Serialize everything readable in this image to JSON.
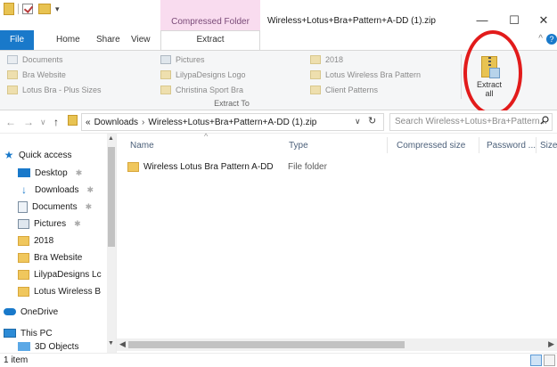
{
  "window": {
    "title": "Wireless+Lotus+Bra+Pattern+A-DD (1).zip",
    "context_tab_header": "Compressed Folder Tools",
    "minimize": "—",
    "maximize": "☐",
    "close": "✕"
  },
  "tabs": {
    "file": "File",
    "home": "Home",
    "share": "Share",
    "view": "View",
    "extract": "Extract"
  },
  "ribbon": {
    "col1": [
      "Documents",
      "Bra Website",
      "Lotus Bra - Plus Sizes"
    ],
    "col2": [
      "Pictures",
      "LilypaDesigns Logo",
      "Christina Sport Bra"
    ],
    "col3": [
      "2018",
      "Lotus Wireless Bra Pattern",
      "Client Patterns"
    ],
    "group_label": "Extract To",
    "extract_all_line1": "Extract",
    "extract_all_line2": "all"
  },
  "address": {
    "overflow": "«",
    "downloads": "Downloads",
    "current": "Wireless+Lotus+Bra+Pattern+A-DD (1).zip",
    "separator": "›",
    "search_placeholder": "Search Wireless+Lotus+Bra+Pattern..."
  },
  "nav": {
    "items": [
      {
        "label": "Quick access",
        "icon": "star-icon"
      },
      {
        "label": "Desktop",
        "icon": "desktop-icon"
      },
      {
        "label": "Downloads",
        "icon": "download-icon"
      },
      {
        "label": "Documents",
        "icon": "document-icon"
      },
      {
        "label": "Pictures",
        "icon": "pictures-icon"
      },
      {
        "label": "2018",
        "icon": "folder-icon"
      },
      {
        "label": "Bra Website",
        "icon": "folder-icon"
      },
      {
        "label": "LilypaDesigns Lc",
        "icon": "folder-icon"
      },
      {
        "label": "Lotus Wireless B",
        "icon": "folder-icon"
      },
      {
        "label": "OneDrive",
        "icon": "cloud-icon"
      },
      {
        "label": "This PC",
        "icon": "pc-icon"
      },
      {
        "label": "3D Objects",
        "icon": "3d-objects-icon"
      }
    ]
  },
  "columns": {
    "name": "Name",
    "type": "Type",
    "compressed_size": "Compressed size",
    "password": "Password ...",
    "size": "Size"
  },
  "files": [
    {
      "name": "Wireless Lotus Bra Pattern A-DD",
      "type": "File folder"
    }
  ],
  "status": {
    "item_count": "1 item"
  }
}
